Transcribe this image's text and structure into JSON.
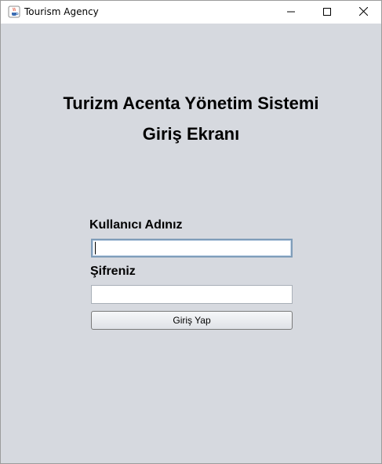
{
  "window": {
    "title": "Tourism Agency",
    "controls": {
      "minimize_icon": "minimize-icon",
      "maximize_icon": "maximize-icon",
      "close_icon": "close-icon"
    },
    "app_icon": "java-cup-icon"
  },
  "login": {
    "heading_line1": "Turizm Acenta Yönetim Sistemi",
    "heading_line2": "Giriş Ekranı",
    "username_label": "Kullanıcı Adınız",
    "username_value": "",
    "password_label": "Şifreniz",
    "password_value": "",
    "submit_label": "Giriş Yap"
  },
  "colors": {
    "client_background": "#d6d9df",
    "titlebar_background": "#ffffff",
    "focus_border": "#7f9db9"
  }
}
